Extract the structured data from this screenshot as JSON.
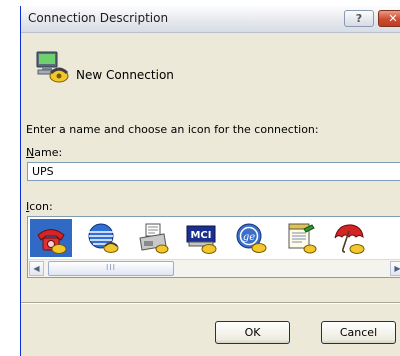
{
  "window": {
    "title": "Connection Description",
    "help_glyph": "?",
    "close_glyph": "✕"
  },
  "header": {
    "icon": "phone-computer-icon",
    "connection_name": "New Connection"
  },
  "form": {
    "instructions": "Enter a name and choose an icon for the connection:",
    "name_label_accel": "N",
    "name_label_rest": "ame:",
    "name_value": "UPS",
    "icon_label_accel": "I",
    "icon_label_rest": "con:"
  },
  "icons": [
    {
      "name": "red-telephone-icon",
      "selected": true
    },
    {
      "name": "globe-phone-icon",
      "selected": false
    },
    {
      "name": "fax-machine-icon",
      "selected": false
    },
    {
      "name": "mci-logo-icon",
      "selected": false
    },
    {
      "name": "ge-logo-icon",
      "selected": false
    },
    {
      "name": "notepad-icon",
      "selected": false
    },
    {
      "name": "umbrella-icon",
      "selected": false
    }
  ],
  "scrollbar": {
    "left_arrow": "◀",
    "right_arrow": "▶",
    "thumb_grip": "III"
  },
  "buttons": {
    "ok": "OK",
    "cancel": "Cancel"
  }
}
